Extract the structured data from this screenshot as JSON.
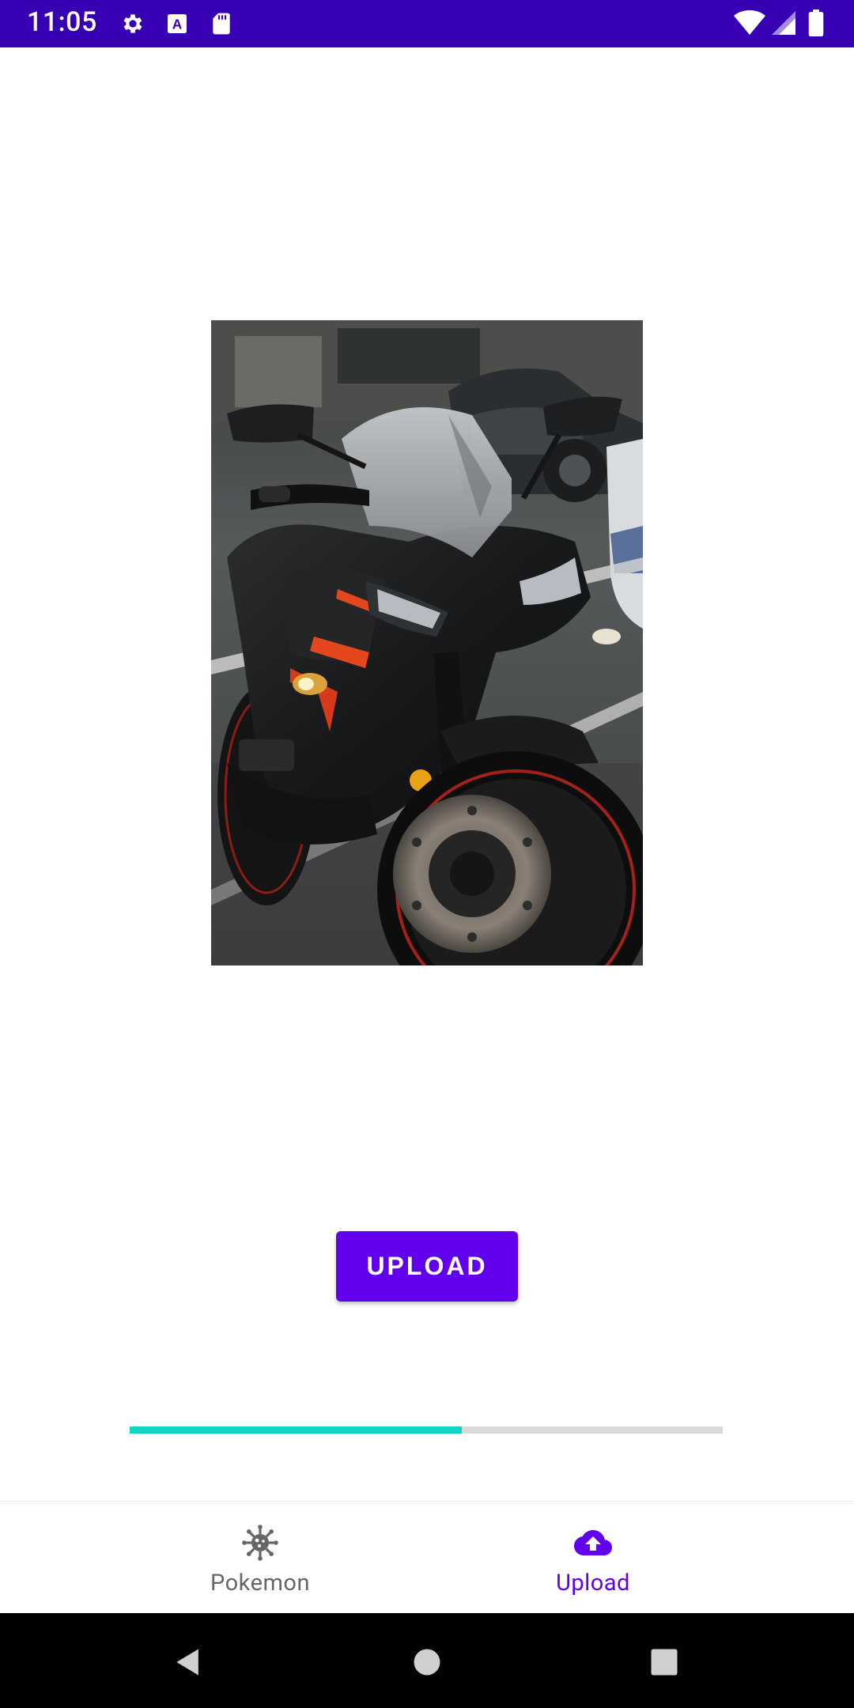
{
  "status_bar": {
    "time": "11:05",
    "background": "#3700B3",
    "left_icons": [
      "gear-icon",
      "text-a-icon",
      "sd-card-icon"
    ],
    "right_icons": [
      "wifi-icon",
      "signal-icon",
      "battery-icon"
    ]
  },
  "main": {
    "photo": {
      "subject": "motorcycle-photo"
    },
    "upload_button": {
      "label": "UPLOAD",
      "color": "#6200EE"
    },
    "progress": {
      "value_fraction": 0.56,
      "fill_color": "#11D6BF",
      "track_color": "#D9D9D9"
    }
  },
  "bottom_nav": {
    "items": [
      {
        "label": "Pokemon",
        "icon": "virus-icon",
        "selected": false
      },
      {
        "label": "Upload",
        "icon": "cloud-upload-icon",
        "selected": true
      }
    ],
    "active_color": "#6200EE",
    "inactive_color": "#666666"
  },
  "system_nav": {
    "buttons": [
      "back-icon",
      "home-icon",
      "recents-icon"
    ]
  }
}
